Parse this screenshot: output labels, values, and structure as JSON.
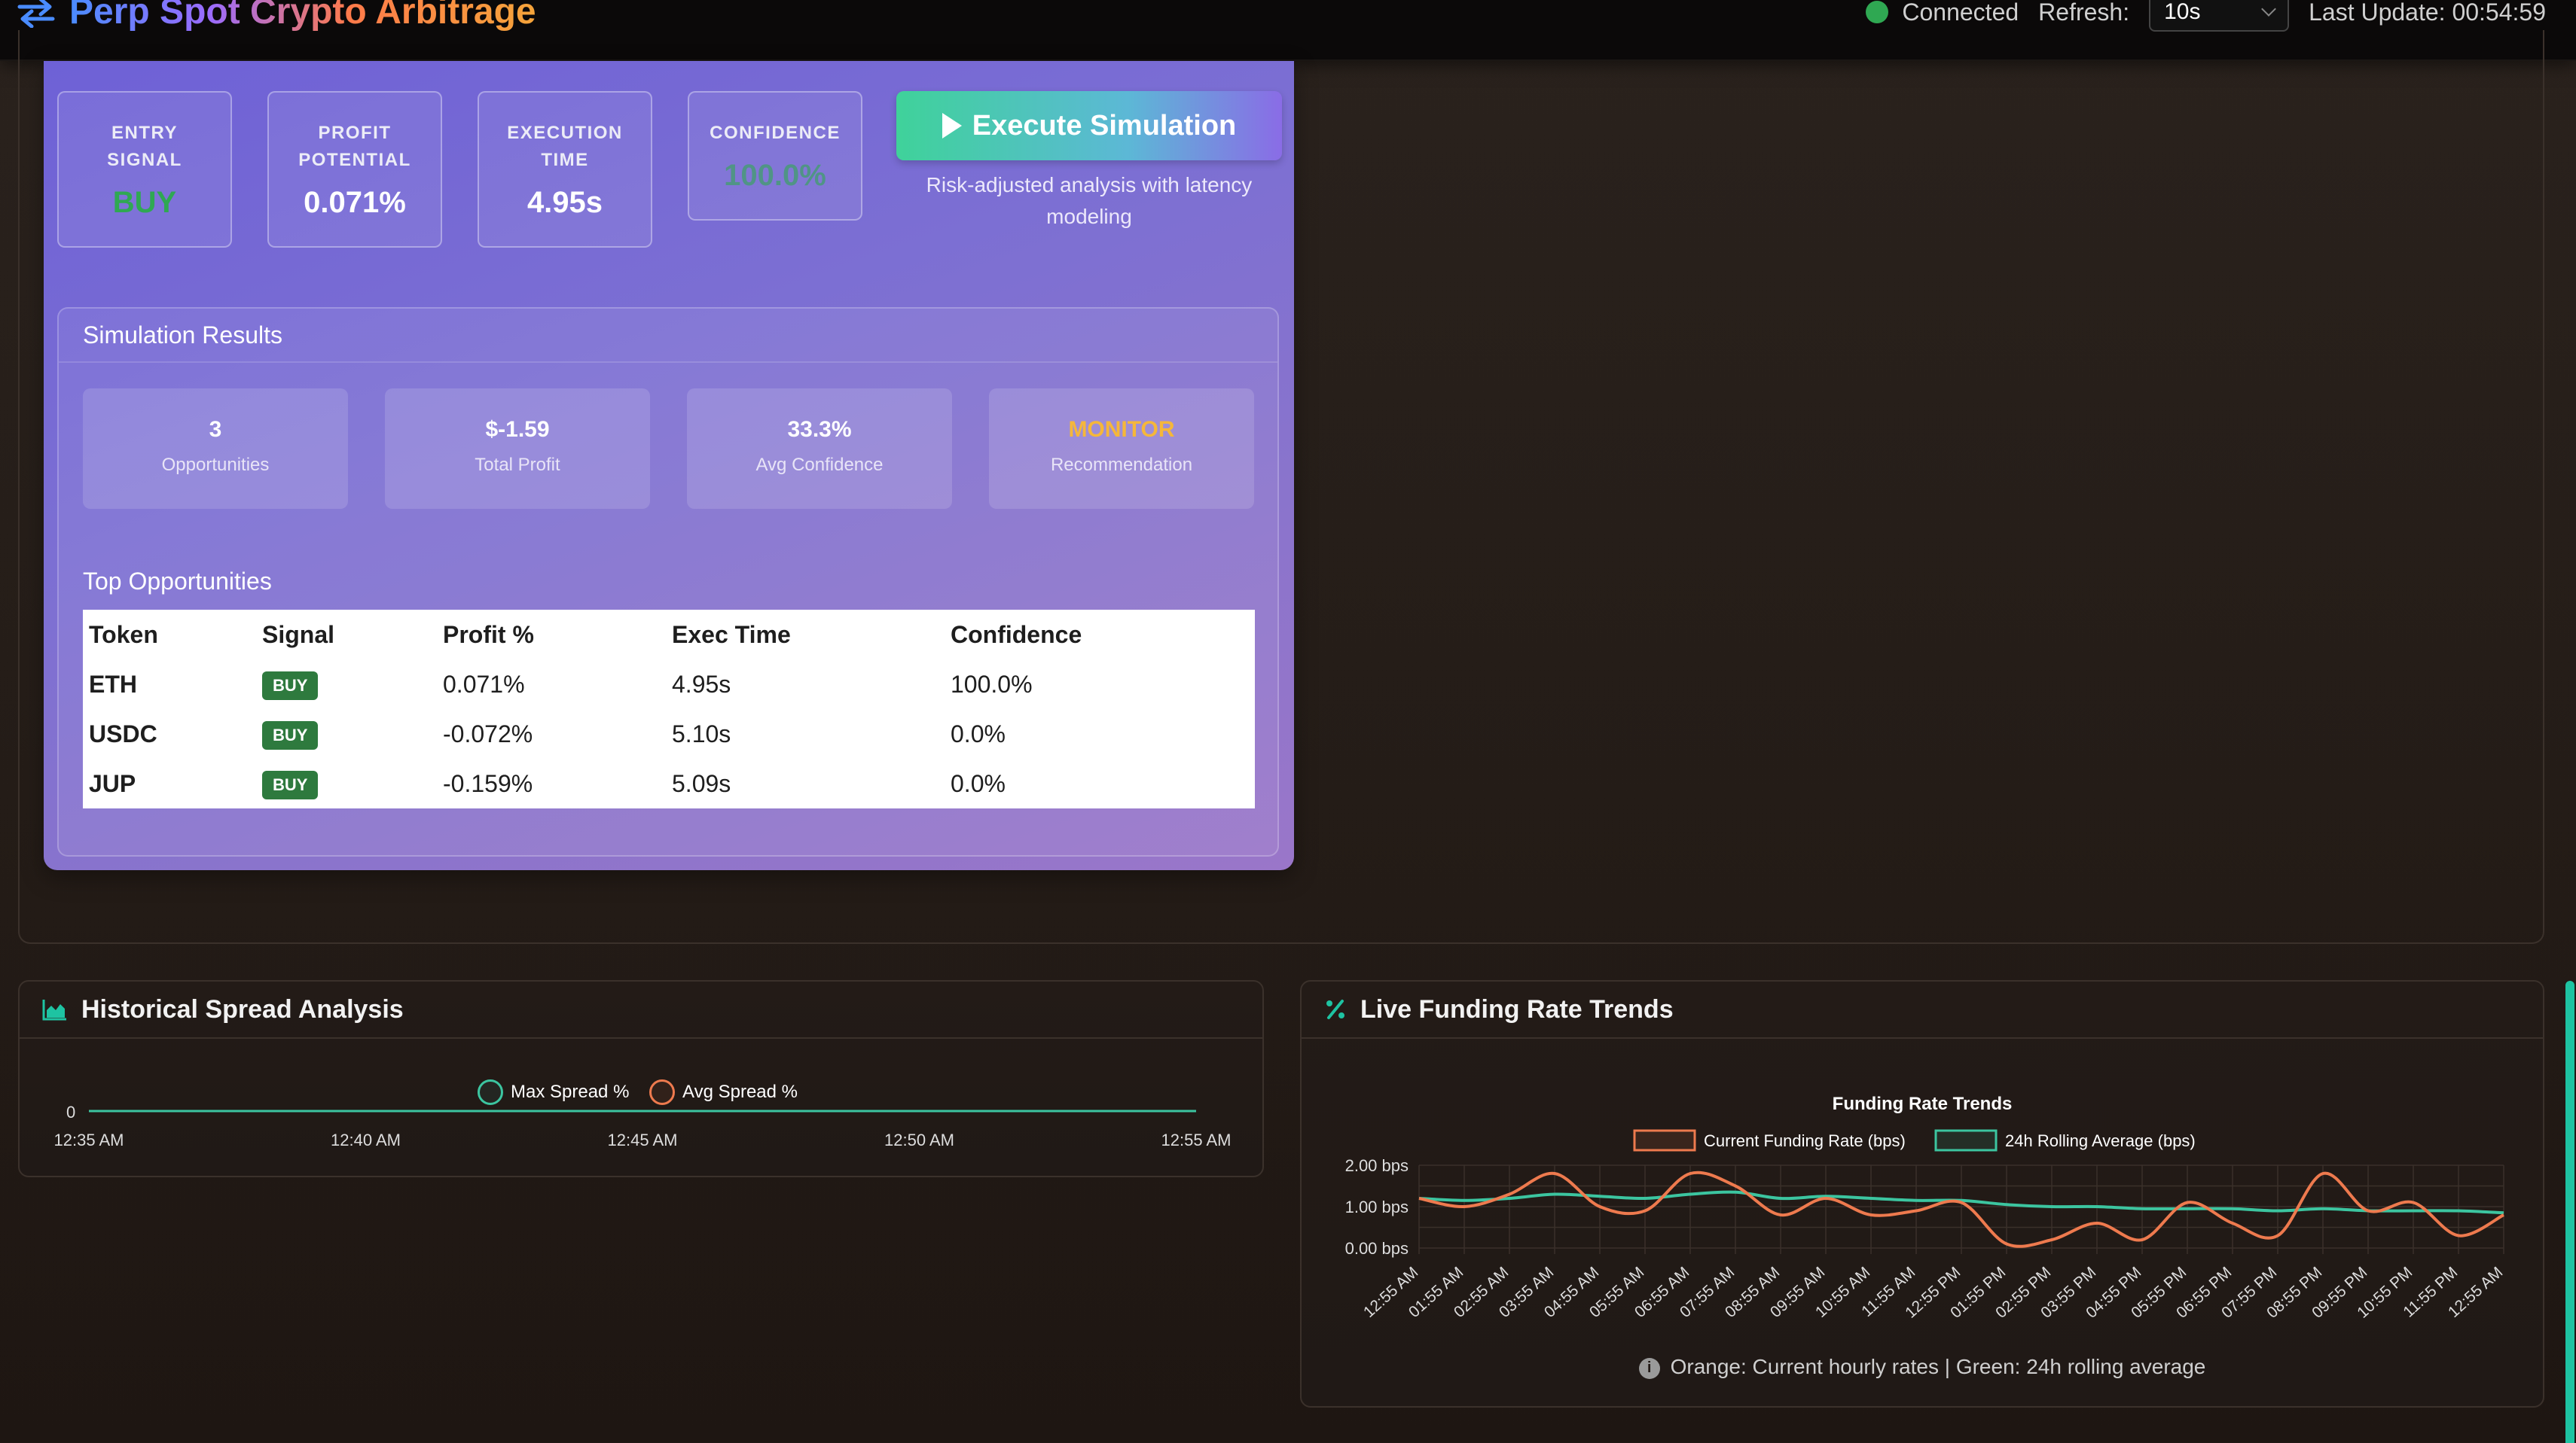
{
  "header": {
    "title": "Perp Spot Crypto Arbitrage",
    "status_text": "Connected",
    "status_color": "#2fa852",
    "refresh_label": "Refresh:",
    "refresh_value": "10s",
    "last_update": "Last Update: 00:54:59"
  },
  "signal_metrics": [
    {
      "label": "ENTRY SIGNAL",
      "value": "BUY"
    },
    {
      "label": "PROFIT POTENTIAL",
      "value": "0.071%"
    },
    {
      "label": "EXECUTION TIME",
      "value": "4.95s"
    },
    {
      "label": "CONFIDENCE",
      "value": "100.0%"
    }
  ],
  "execute": {
    "label": "Execute Simulation",
    "subtitle": "Risk-adjusted analysis with latency modeling"
  },
  "results": {
    "title": "Simulation Results",
    "stats": [
      {
        "value": "3",
        "label": "Opportunities"
      },
      {
        "value": "$-1.59",
        "label": "Total Profit"
      },
      {
        "value": "33.3%",
        "label": "Avg Confidence"
      },
      {
        "value": "MONITOR",
        "label": "Recommendation"
      }
    ],
    "top_title": "Top Opportunities",
    "columns": [
      "Token",
      "Signal",
      "Profit %",
      "Exec Time",
      "Confidence"
    ],
    "rows": [
      {
        "token": "ETH",
        "signal": "BUY",
        "profit": "0.071%",
        "exec": "4.95s",
        "confidence": "100.0%"
      },
      {
        "token": "USDC",
        "signal": "BUY",
        "profit": "-0.072%",
        "exec": "5.10s",
        "confidence": "0.0%"
      },
      {
        "token": "JUP",
        "signal": "BUY",
        "profit": "-0.159%",
        "exec": "5.09s",
        "confidence": "0.0%"
      }
    ]
  },
  "historical": {
    "title": "Historical Spread Analysis",
    "icon": "area-chart-icon"
  },
  "funding": {
    "title": "Live Funding Rate Trends",
    "icon": "percent-icon",
    "note": "Orange: Current hourly rates | Green: 24h rolling average"
  },
  "colors": {
    "accent_green": "#1ec3a2",
    "orange_line": "#ee7a4e",
    "green_line": "#3cc5a0",
    "monitor": "#f5b73a"
  },
  "chart_data": [
    {
      "type": "line",
      "x": [
        "12:35 AM",
        "12:40 AM",
        "12:45 AM",
        "12:50 AM",
        "12:55 AM"
      ],
      "series": [
        {
          "name": "Max Spread %",
          "values": [
            0,
            0,
            0,
            0,
            0
          ]
        },
        {
          "name": "Avg Spread %",
          "values": [
            0,
            0,
            0,
            0,
            0
          ]
        }
      ],
      "ytick": "0",
      "ylim": [
        0,
        0
      ]
    },
    {
      "type": "line",
      "title": "Funding Rate Trends",
      "x": [
        "12:55 AM",
        "01:55 AM",
        "02:55 AM",
        "03:55 AM",
        "04:55 AM",
        "05:55 AM",
        "06:55 AM",
        "07:55 AM",
        "08:55 AM",
        "09:55 AM",
        "10:55 AM",
        "11:55 AM",
        "12:55 PM",
        "01:55 PM",
        "02:55 PM",
        "03:55 PM",
        "04:55 PM",
        "05:55 PM",
        "06:55 PM",
        "07:55 PM",
        "08:55 PM",
        "09:55 PM",
        "10:55 PM",
        "11:55 PM",
        "12:55 AM"
      ],
      "yticks": [
        "2.00 bps",
        "1.00 bps",
        "0.00 bps"
      ],
      "ylim": [
        0,
        2
      ],
      "series": [
        {
          "name": "Current Funding Rate (bps)",
          "values": [
            1.2,
            1.0,
            1.3,
            1.8,
            1.0,
            0.9,
            1.8,
            1.5,
            0.8,
            1.2,
            0.8,
            0.9,
            1.1,
            0.1,
            0.2,
            0.6,
            0.2,
            1.1,
            0.6,
            0.3,
            1.8,
            0.9,
            1.1,
            0.3,
            0.8
          ]
        },
        {
          "name": "24h Rolling Average (bps)",
          "values": [
            1.2,
            1.15,
            1.2,
            1.3,
            1.25,
            1.2,
            1.3,
            1.35,
            1.2,
            1.25,
            1.2,
            1.15,
            1.15,
            1.05,
            1.0,
            1.0,
            0.95,
            0.95,
            0.95,
            0.9,
            0.95,
            0.9,
            0.9,
            0.9,
            0.85
          ]
        }
      ],
      "legend": "top"
    }
  ]
}
